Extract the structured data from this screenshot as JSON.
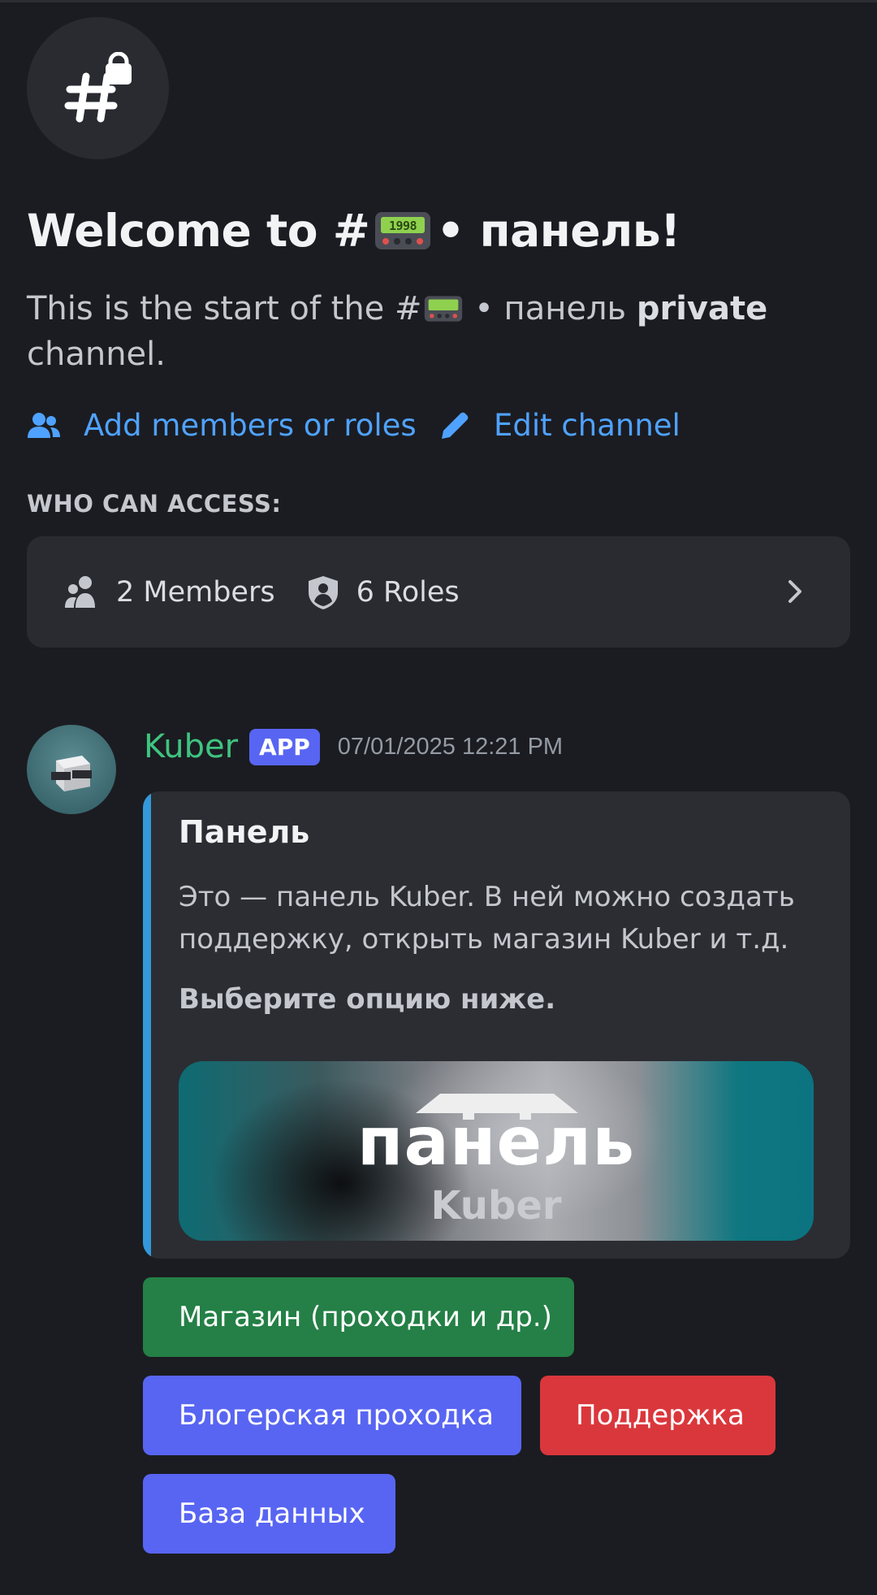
{
  "channel": {
    "welcome_prefix": "Welcome to #",
    "welcome_suffix": " • панель!",
    "sub_prefix": "This is the start of the #",
    "sub_mid": " • панель ",
    "sub_bold": "private",
    "sub_end": "channel."
  },
  "actions": {
    "add_members": "Add members or roles",
    "edit_channel": "Edit channel"
  },
  "access": {
    "header": "WHO CAN ACCESS:",
    "members": "2 Members",
    "roles": "6 Roles"
  },
  "message": {
    "username": "Kuber",
    "badge": "APP",
    "timestamp": "07/01/2025 12:21 PM",
    "embed": {
      "title": "Панель",
      "description": "Это — панель Kuber. В ней можно создать поддержку, открыть магазин Kuber и т.д.",
      "bold_text": "Выберите опцию ниже.",
      "banner_line1": "панель",
      "banner_line2": "Kuber"
    },
    "buttons": {
      "shop": "Магазин (проходки и др.)",
      "blogger": "Блогерская проходка",
      "support": "Поддержка",
      "database": "База данных"
    }
  },
  "colors": {
    "background": "#1b1c21",
    "link": "#4fa2ff",
    "username": "#3ec480",
    "embed_accent": "#3498db",
    "button_green": "#248046",
    "button_blurple": "#5865f2",
    "button_red": "#da373c"
  },
  "icons": {
    "channel": "hash-lock-icon",
    "pager": "pager-emoji-icon",
    "add_members": "people-icon",
    "edit": "pencil-icon",
    "members": "members-icon",
    "roles": "shield-icon",
    "chevron": "chevron-right-icon"
  }
}
